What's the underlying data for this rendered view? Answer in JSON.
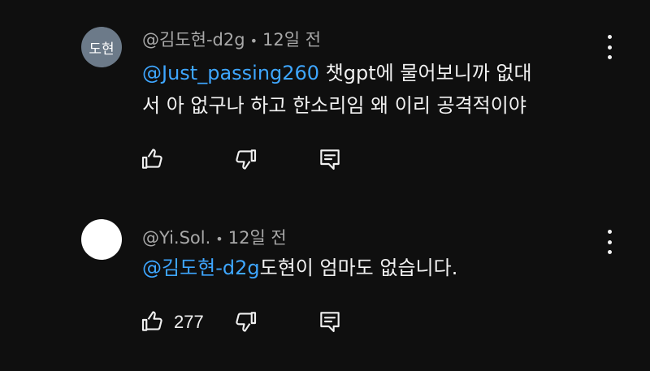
{
  "comments": [
    {
      "avatar_text": "도현",
      "author": "@김도현-d2g",
      "separator": "•",
      "time": "12일 전",
      "mention": "@Just_passing260",
      "text_line1": " 챗gpt에 물어보니까 없대",
      "text_line2": "서 아 없구나 하고 한소리임 왜 이리 공격적이야",
      "likes": ""
    },
    {
      "avatar_text": "",
      "author": "@Yi.Sol.",
      "separator": "•",
      "time": "12일 전",
      "mention": "@김도현-d2g",
      "text_line1": "도현이 엄마도 없습니다.",
      "text_line2": "",
      "likes": "277"
    }
  ],
  "icons": {
    "like": "thumbs-up-icon",
    "dislike": "thumbs-down-icon",
    "reply": "reply-icon",
    "more": "more-vert-icon"
  },
  "colors": {
    "background": "#0f0f0f",
    "mention": "#3ea6ff",
    "meta": "#a8a8a8",
    "avatar1": "#6c7a89"
  }
}
